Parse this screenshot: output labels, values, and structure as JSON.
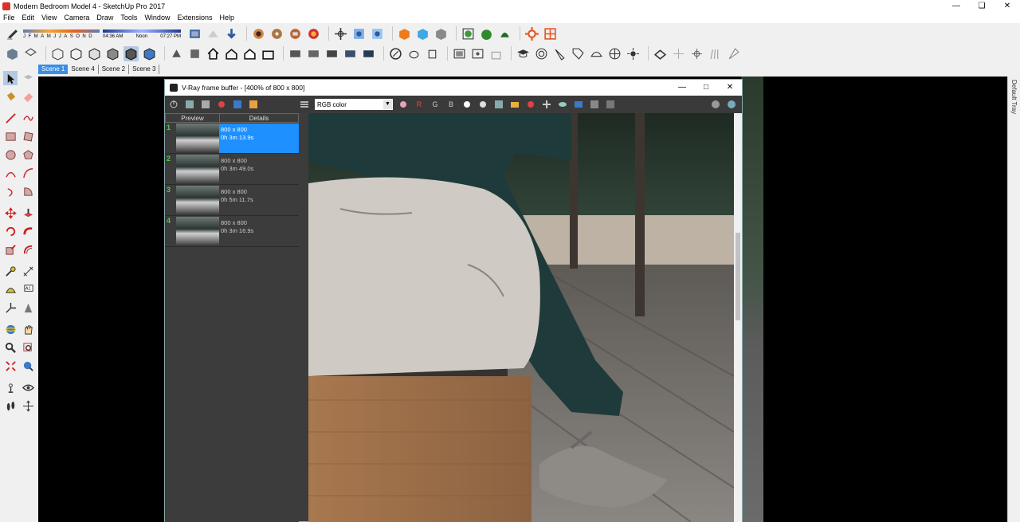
{
  "window": {
    "title": "Modern Bedroom Model 4 - SketchUp Pro 2017"
  },
  "menu": [
    "File",
    "Edit",
    "View",
    "Camera",
    "Draw",
    "Tools",
    "Window",
    "Extensions",
    "Help"
  ],
  "shadows": {
    "months": [
      "J",
      "F",
      "M",
      "A",
      "M",
      "J",
      "J",
      "A",
      "S",
      "O",
      "N",
      "D"
    ],
    "time_start": "04:36 AM",
    "time_noon": "Noon",
    "time_end": "07:27 PM"
  },
  "scenes": [
    "Scene 1",
    "Scene 4",
    "Scene 2",
    "Scene 3"
  ],
  "tray": {
    "label": "Default Tray"
  },
  "vfb": {
    "title": "V-Ray frame buffer - [400% of 800 x 800]",
    "channel": "RGB color",
    "channel_buttons": [
      "R",
      "G",
      "B"
    ],
    "history_headers": {
      "preview": "Preview",
      "details": "Details"
    },
    "history": [
      {
        "num": "1",
        "res": "800 x 800",
        "time": "0h 3m 13.9s",
        "selected": true
      },
      {
        "num": "2",
        "res": "800 x 800",
        "time": "0h 3m 49.0s",
        "selected": false
      },
      {
        "num": "3",
        "res": "800 x 800",
        "time": "0h 5m 11.7s",
        "selected": false
      },
      {
        "num": "4",
        "res": "800 x 800",
        "time": "0h 3m 16.9s",
        "selected": false
      }
    ]
  },
  "colors": {
    "accent": "#1e90ff",
    "scene_active": "#3a8ee6",
    "history_num": "#3fd33f"
  }
}
